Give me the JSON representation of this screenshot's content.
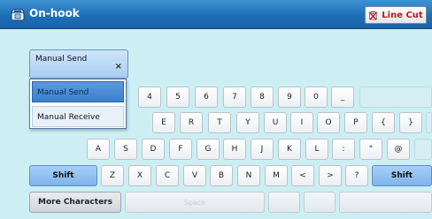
{
  "title": "On-hook",
  "line_cut_label": "Line Cut",
  "dropdown": {
    "selected": "Manual Send",
    "clear_label": "×"
  },
  "menu": {
    "options": [
      "Manual Send",
      "Manual Receive"
    ]
  },
  "row1_keys": [
    "4",
    "5",
    "6",
    "7",
    "8",
    "9",
    "0",
    "_"
  ],
  "row2_keys": [
    "E",
    "R",
    "T",
    "Y",
    "U",
    "I",
    "O",
    "P",
    "{",
    "}"
  ],
  "row3_keys": [
    "A",
    "S",
    "D",
    "F",
    "G",
    "H",
    "J",
    "K",
    "L",
    ":",
    "\"",
    "@"
  ],
  "row4": {
    "shift_left": "Shift",
    "keys": [
      "Z",
      "X",
      "C",
      "V",
      "B",
      "N",
      "M",
      "<",
      ">",
      "?"
    ],
    "shift_right": "Shift"
  },
  "bottom": {
    "more_characters": "More Characters",
    "space": "Space"
  },
  "colors": {
    "title_bar": "#1d6fb7",
    "background": "#c8eef2",
    "line_cut_text": "#c0181b"
  }
}
